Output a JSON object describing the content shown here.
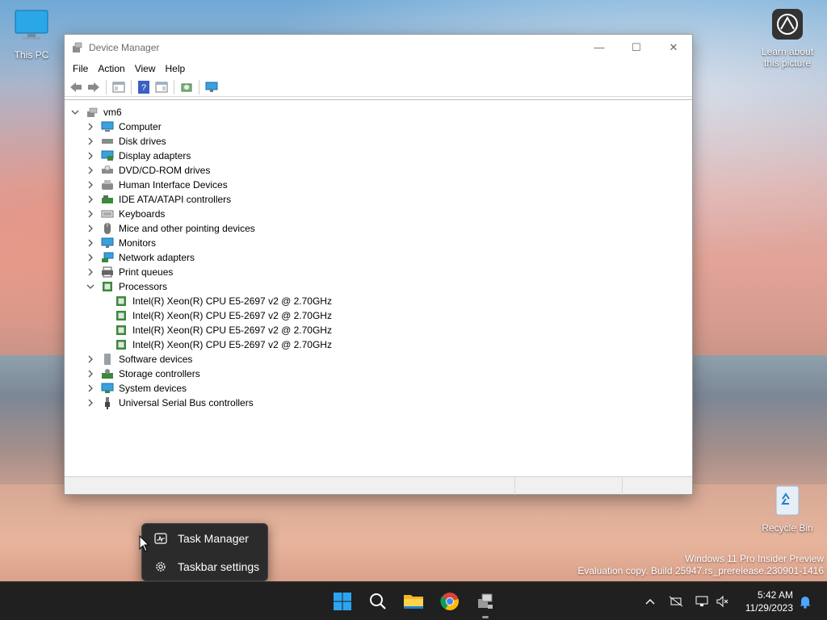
{
  "desktop": {
    "icons": [
      {
        "label": "This PC"
      },
      {
        "label": "Learn about this picture"
      },
      {
        "label": "Recycle Bin"
      }
    ]
  },
  "window": {
    "title": "Device Manager",
    "controls": {
      "minimize": "—",
      "maximize": "☐",
      "close": "✕"
    },
    "menu": [
      "File",
      "Action",
      "View",
      "Help"
    ],
    "tree": {
      "root": "vm6",
      "categories": [
        {
          "label": "Computer",
          "icon": "computer-icon"
        },
        {
          "label": "Disk drives",
          "icon": "disk-drive-icon"
        },
        {
          "label": "Display adapters",
          "icon": "display-adapter-icon"
        },
        {
          "label": "DVD/CD-ROM drives",
          "icon": "dvd-drive-icon"
        },
        {
          "label": "Human Interface Devices",
          "icon": "hid-icon"
        },
        {
          "label": "IDE ATA/ATAPI controllers",
          "icon": "ide-controller-icon"
        },
        {
          "label": "Keyboards",
          "icon": "keyboard-icon"
        },
        {
          "label": "Mice and other pointing devices",
          "icon": "mouse-icon"
        },
        {
          "label": "Monitors",
          "icon": "monitor-icon"
        },
        {
          "label": "Network adapters",
          "icon": "network-adapter-icon"
        },
        {
          "label": "Print queues",
          "icon": "printer-icon"
        },
        {
          "label": "Processors",
          "icon": "processor-icon",
          "expanded": true,
          "children": [
            "Intel(R) Xeon(R) CPU E5-2697 v2 @ 2.70GHz",
            "Intel(R) Xeon(R) CPU E5-2697 v2 @ 2.70GHz",
            "Intel(R) Xeon(R) CPU E5-2697 v2 @ 2.70GHz",
            "Intel(R) Xeon(R) CPU E5-2697 v2 @ 2.70GHz"
          ]
        },
        {
          "label": "Software devices",
          "icon": "software-device-icon"
        },
        {
          "label": "Storage controllers",
          "icon": "storage-controller-icon"
        },
        {
          "label": "System devices",
          "icon": "system-device-icon"
        },
        {
          "label": "Universal Serial Bus controllers",
          "icon": "usb-icon"
        }
      ]
    }
  },
  "context_menu": {
    "items": [
      {
        "label": "Task Manager",
        "icon": "task-manager-icon"
      },
      {
        "label": "Taskbar settings",
        "icon": "gear-icon"
      }
    ]
  },
  "watermark": {
    "line1": "Windows 11 Pro Insider Preview",
    "line2": "Evaluation copy. Build 25947.rs_prerelease.230901-1416"
  },
  "taskbar": {
    "apps": [
      "start-icon",
      "search-icon",
      "file-explorer-icon",
      "chrome-icon",
      "device-manager-icon"
    ],
    "tray": [
      "chevron-up-icon",
      "network-off-icon",
      "display-icon",
      "volume-muted-icon",
      "notification-bell-icon"
    ],
    "time": "5:42 AM",
    "date": "11/29/2023"
  }
}
